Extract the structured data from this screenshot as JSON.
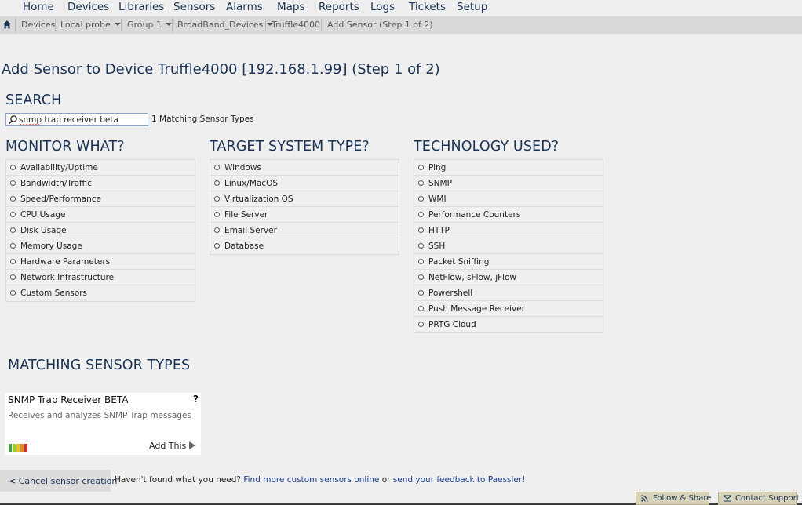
{
  "nav": {
    "items": [
      {
        "id": "home",
        "label": "Home"
      },
      {
        "id": "devices",
        "label": "Devices"
      },
      {
        "id": "libraries",
        "label": "Libraries"
      },
      {
        "id": "sensors",
        "label": "Sensors"
      },
      {
        "id": "alarms",
        "label": "Alarms"
      },
      {
        "id": "maps",
        "label": "Maps"
      },
      {
        "id": "reports",
        "label": "Reports"
      },
      {
        "id": "logs",
        "label": "Logs"
      },
      {
        "id": "tickets",
        "label": "Tickets"
      },
      {
        "id": "setup",
        "label": "Setup"
      }
    ]
  },
  "breadcrumb": {
    "devices": "Devices",
    "probe": "Local probe",
    "group": "Group 1",
    "subgroup": "BroadBand_Devices",
    "device": "Truffle4000",
    "current": "Add Sensor (Step 1 of 2)"
  },
  "page": {
    "title": "Add Sensor to Device Truffle4000 [192.168.1.99]  (Step 1 of 2)"
  },
  "search": {
    "heading": "SEARCH",
    "value": "snmp trap receiver beta",
    "match_count": "1 Matching Sensor Types"
  },
  "monitor_what": {
    "heading": "MONITOR WHAT?",
    "items": [
      "Availability/Uptime",
      "Bandwidth/Traffic",
      "Speed/Performance",
      "CPU Usage",
      "Disk Usage",
      "Memory Usage",
      "Hardware Parameters",
      "Network Infrastructure",
      "Custom Sensors"
    ]
  },
  "target_system": {
    "heading": "TARGET SYSTEM TYPE?",
    "items": [
      "Windows",
      "Linux/MacOS",
      "Virtualization OS",
      "File Server",
      "Email Server",
      "Database"
    ]
  },
  "technology": {
    "heading": "TECHNOLOGY USED?",
    "items": [
      "Ping",
      "SNMP",
      "WMI",
      "Performance Counters",
      "HTTP",
      "SSH",
      "Packet Sniffing",
      "NetFlow, sFlow, jFlow",
      "Powershell",
      "Push Message Receiver",
      "PRTG Cloud"
    ]
  },
  "matching": {
    "heading": "MATCHING SENSOR TYPES",
    "card": {
      "title": "SNMP Trap Receiver BETA",
      "help": "?",
      "description": "Receives and analyzes SNMP Trap messages",
      "add_label": "Add This",
      "perf_colors": [
        "#3aa63a",
        "#9fcc2a",
        "#e8c21c",
        "#e8871c",
        "#d22a2a"
      ]
    }
  },
  "footer": {
    "cancel_label": "< Cancel sensor creation",
    "question": "Haven't found what you need?",
    "link1": "Find more custom sensors online",
    "or": "or",
    "link2": "send your feedback to Paessler!",
    "follow_share": "Follow & Share",
    "contact_support": "Contact Support"
  },
  "colors": {
    "heading": "#1a3354",
    "background": "#efefef",
    "link": "#1a3d8f",
    "breadcrumb_bg": "#dadada"
  }
}
